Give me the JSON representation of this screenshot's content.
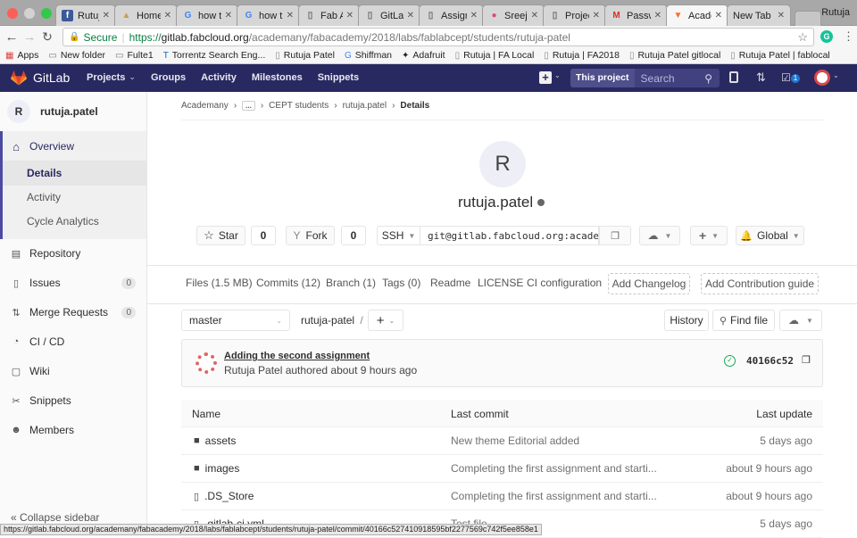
{
  "browser": {
    "tabs": [
      {
        "label": "Rutuja",
        "icon": "facebook-icon"
      },
      {
        "label": "Homeb",
        "icon": "lock-icon"
      },
      {
        "label": "how to",
        "icon": "google-icon"
      },
      {
        "label": "how th",
        "icon": "google-icon"
      },
      {
        "label": "Fab Ac",
        "icon": "page-icon"
      },
      {
        "label": "GitLab",
        "icon": "page-icon"
      },
      {
        "label": "Assign",
        "icon": "page-icon"
      },
      {
        "label": "Sreejitl",
        "icon": "avatar-icon"
      },
      {
        "label": "Project",
        "icon": "page-icon"
      },
      {
        "label": "Passw",
        "icon": "gmail-icon"
      },
      {
        "label": "Acader",
        "icon": "gitlab-icon",
        "active": true
      },
      {
        "label": "New Tab",
        "icon": ""
      }
    ],
    "profile_name": "Rutuja",
    "secure_label": "Secure",
    "url_scheme": "https://",
    "url_host": "gitlab.fabcloud.org",
    "url_path": "/academany/fabacademy/2018/labs/fablabcept/students/rutuja-patel",
    "bookmarks": [
      {
        "label": "Apps",
        "icon": "apps-icon"
      },
      {
        "label": "New folder",
        "icon": "folder-icon"
      },
      {
        "label": "Fulte1",
        "icon": "folder-icon"
      },
      {
        "label": "Torrentz Search Eng...",
        "icon": "torrentz-icon"
      },
      {
        "label": "Rutuja Patel",
        "icon": "page-icon"
      },
      {
        "label": "Shiffman",
        "icon": "google-icon"
      },
      {
        "label": "Adafruit",
        "icon": "adafruit-icon"
      },
      {
        "label": "Rutuja | FA Local",
        "icon": "page-icon"
      },
      {
        "label": "Rutuja | FA2018",
        "icon": "page-icon"
      },
      {
        "label": "Rutuja Patel gitlocal",
        "icon": "page-icon"
      },
      {
        "label": "Rutuja Patel | fablocal",
        "icon": "page-icon"
      }
    ],
    "status_url": "https://gitlab.fabcloud.org/academany/fabacademy/2018/labs/fablabcept/students/rutuja-patel/commit/40166c527410918595bf2277569c742f5ee858e1"
  },
  "gitlab_nav": {
    "brand": "GitLab",
    "items": [
      "Projects",
      "Groups",
      "Activity",
      "Milestones",
      "Snippets"
    ],
    "search_scope": "This project",
    "search_placeholder": "Search",
    "todos_count": "1"
  },
  "sidebar": {
    "project_initial": "R",
    "project_name": "rutuja.patel",
    "overview_label": "Overview",
    "sub_items": [
      "Details",
      "Activity",
      "Cycle Analytics"
    ],
    "items": [
      {
        "label": "Repository",
        "icon": "repository-icon"
      },
      {
        "label": "Issues",
        "icon": "issues-icon",
        "count": "0"
      },
      {
        "label": "Merge Requests",
        "icon": "merge-request-icon",
        "count": "0"
      },
      {
        "label": "CI / CD",
        "icon": "ci-cd-icon"
      },
      {
        "label": "Wiki",
        "icon": "wiki-icon"
      },
      {
        "label": "Snippets",
        "icon": "snippets-icon"
      },
      {
        "label": "Members",
        "icon": "members-icon"
      }
    ],
    "collapse_label": "Collapse sidebar"
  },
  "breadcrumb": [
    "Academany",
    "...",
    "CEPT students",
    "rutuja.patel",
    "Details"
  ],
  "project": {
    "initial": "R",
    "name": "rutuja.patel",
    "star_label": "Star",
    "star_count": "0",
    "fork_label": "Fork",
    "fork_count": "0",
    "clone_protocol": "SSH",
    "clone_url": "git@gitlab.fabcloud.org:academany/fabacademy/2018/labs/fablabcept/students/rutuja-patel.git",
    "notification_level": "Global"
  },
  "stats_links": [
    "Files (1.5 MB)",
    "Commits (12)",
    "Branch (1)",
    "Tags (0)",
    "Readme",
    "LICENSE",
    "CI configuration"
  ],
  "add_buttons": [
    "Add Changelog",
    "Add Contribution guide"
  ],
  "repo_toolbar": {
    "branch": "master",
    "path_root": "rutuja-patel",
    "path_sep": "/",
    "history_label": "History",
    "find_file_label": "Find file"
  },
  "last_commit": {
    "title": "Adding the second assignment",
    "author_line": "Rutuja Patel authored about 9 hours ago",
    "sha": "40166c52",
    "status": "success",
    "status_color": "#1aaa55"
  },
  "file_table": {
    "headers": [
      "Name",
      "Last commit",
      "Last update"
    ],
    "rows": [
      {
        "name": "assets",
        "type": "folder",
        "commit": "New theme Editorial added",
        "date": "5 days ago"
      },
      {
        "name": "images",
        "type": "folder",
        "commit": "Completing the first assignment and starti...",
        "date": "about 9 hours ago"
      },
      {
        "name": ".DS_Store",
        "type": "file",
        "commit": "Completing the first assignment and starti...",
        "date": "about 9 hours ago"
      },
      {
        "name": ".gitlab-ci.yml",
        "type": "file",
        "commit": "Test file",
        "date": "5 days ago"
      }
    ]
  },
  "colors": {
    "nav_bg": "#292961",
    "accent": "#4b4ba3",
    "tanuki": "#fc6d26"
  }
}
